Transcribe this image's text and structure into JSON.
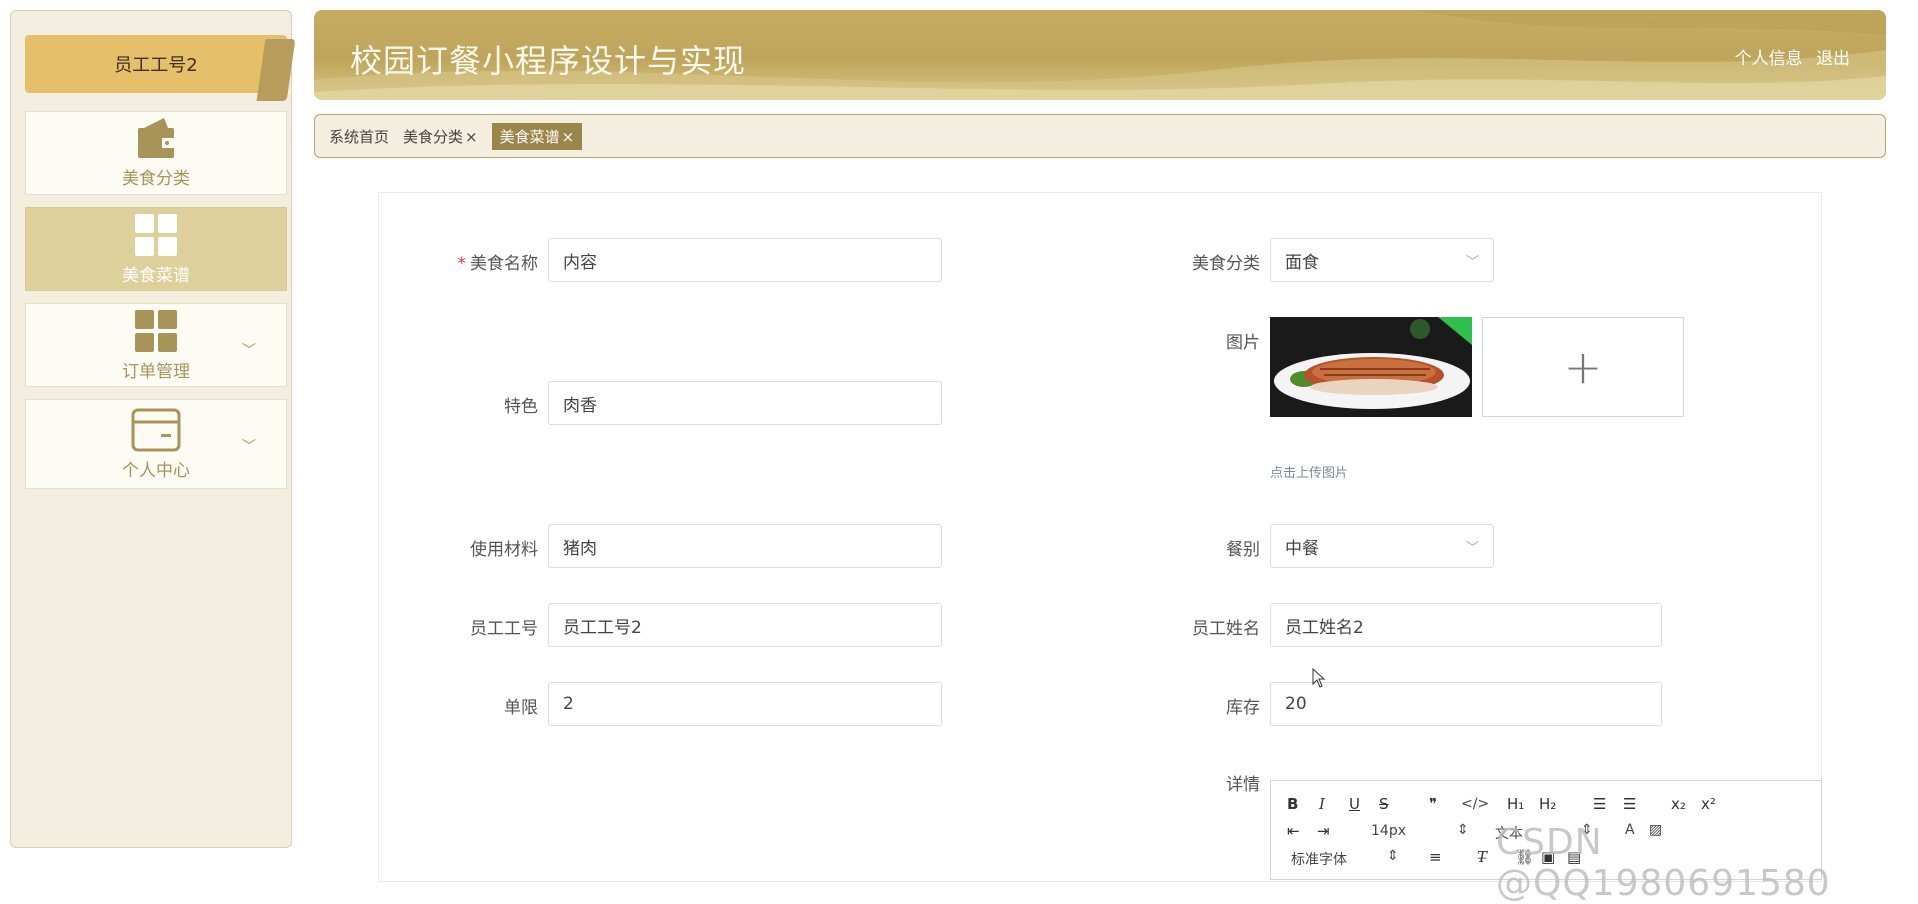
{
  "app": {
    "title": "校园订餐小程序设计与实现",
    "profile_link": "个人信息",
    "logout_link": "退出"
  },
  "sidebar": {
    "user": "员工工号2",
    "items": [
      {
        "label": "美食分类",
        "icon": "wallet-icon"
      },
      {
        "label": "美食菜谱",
        "icon": "grid-icon"
      },
      {
        "label": "订单管理",
        "icon": "grid-icon"
      },
      {
        "label": "个人中心",
        "icon": "card-icon"
      }
    ]
  },
  "tabs": [
    {
      "label": "系统首页"
    },
    {
      "label": "美食分类",
      "close": "×"
    },
    {
      "label": "美食菜谱",
      "close": "×"
    }
  ],
  "form": {
    "name": {
      "label": "美食名称",
      "value": "内容",
      "required": "*"
    },
    "category": {
      "label": "美食分类",
      "value": "面食"
    },
    "image": {
      "label": "图片",
      "hint": "点击上传图片",
      "add_symbol": "+"
    },
    "feature": {
      "label": "特色",
      "value": "肉香"
    },
    "material": {
      "label": "使用材料",
      "value": "猪肉"
    },
    "meal": {
      "label": "餐别",
      "value": "中餐"
    },
    "staff_id": {
      "label": "员工工号",
      "value": "员工工号2"
    },
    "staff_name": {
      "label": "员工姓名",
      "value": "员工姓名2"
    },
    "limit": {
      "label": "单限",
      "value": "2"
    },
    "stock": {
      "label": "库存",
      "value": "20"
    },
    "detail": {
      "label": "详情"
    }
  },
  "editor": {
    "bold": "B",
    "italic": "I",
    "underline": "U",
    "strike": "S",
    "quote": "❞",
    "code": "</>",
    "h1": "H₁",
    "h2": "H₂",
    "ol": "☰",
    "ul": "☰",
    "sub": "x₂",
    "sup": "x²",
    "font_size": "14px",
    "text_type": "文本",
    "font_family": "标准字体"
  },
  "watermark": "CSDN @QQ1980691580",
  "colors": {
    "accent": "#bfa55b",
    "active_tab": "#9a854a",
    "menu_active": "#ddd09a"
  }
}
